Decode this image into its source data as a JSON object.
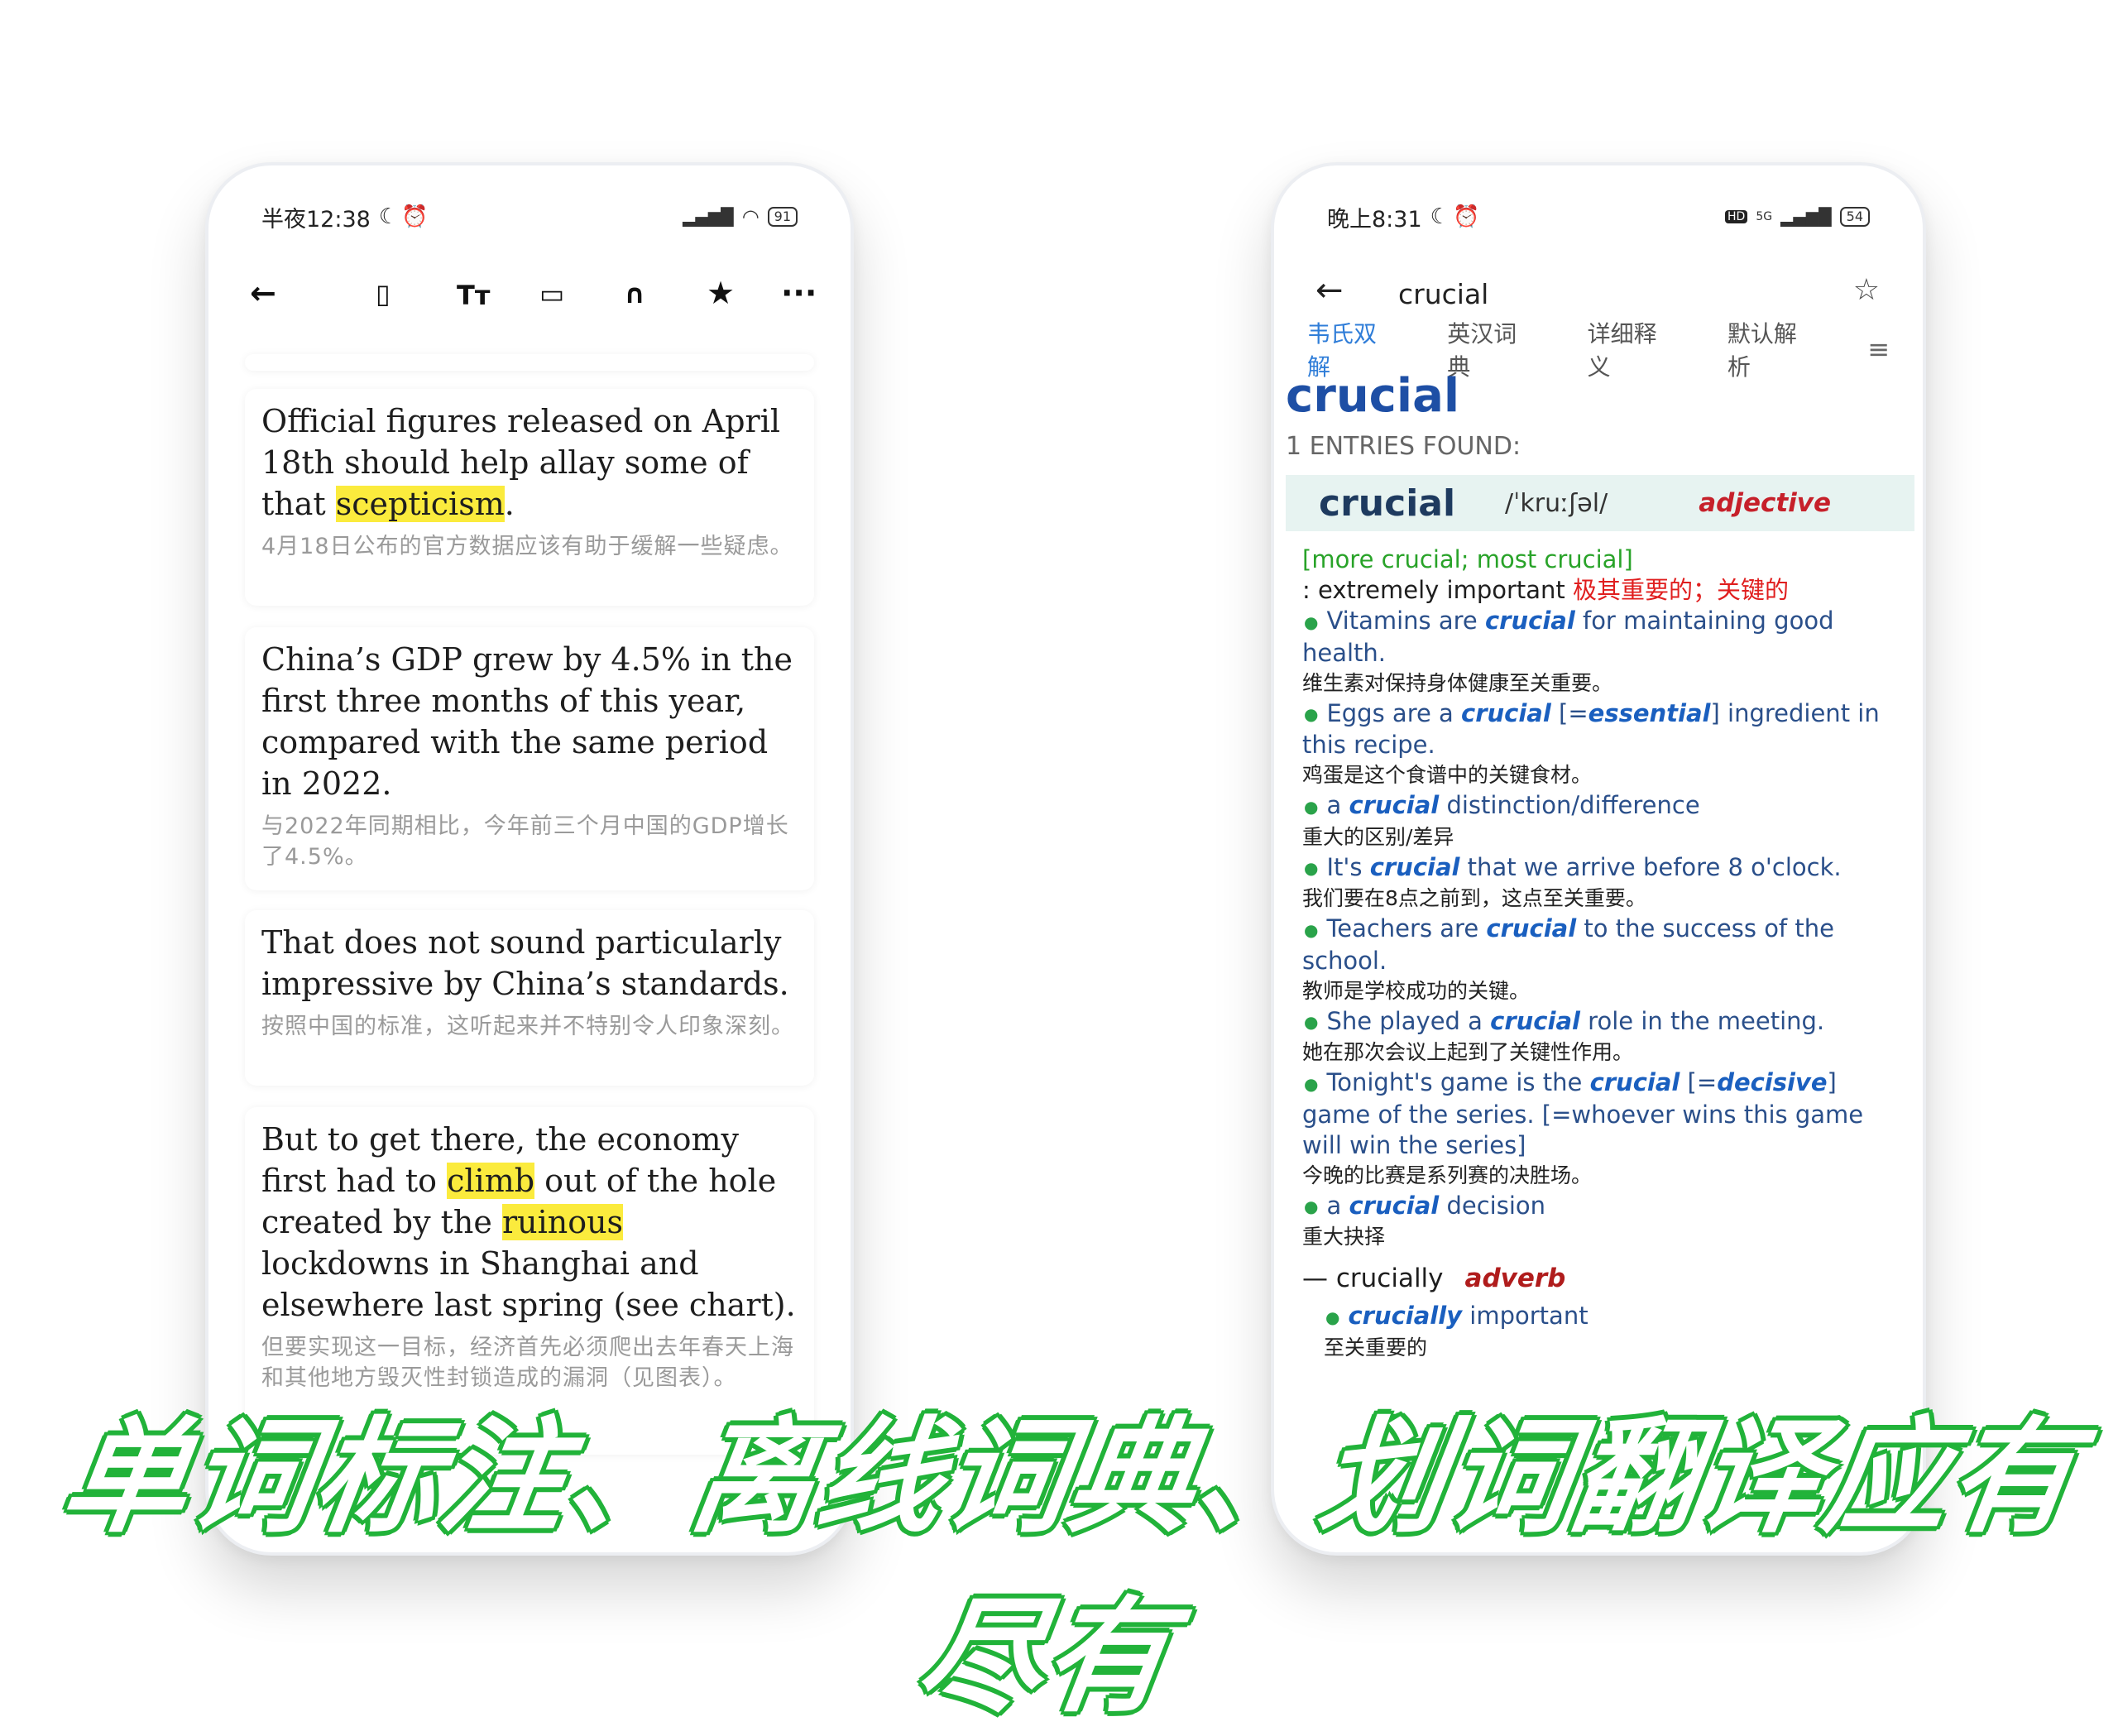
{
  "left_phone": {
    "status": {
      "time": "半夜12:38",
      "battery": "91"
    },
    "toolbar": [
      "back-arrow",
      "bookmark",
      "font-size",
      "reader-layout",
      "headphones",
      "star",
      "more"
    ],
    "cards": [
      {
        "en_parts": [
          "Official figures released on April 18th should help allay some of that ",
          "scepticism",
          "."
        ],
        "zh": "4月18日公布的官方数据应该有助于缓解一些疑虑。"
      },
      {
        "en_parts": [
          "China’s GDP grew by 4.5% in the first three months of this year, compared with the same period in 2022."
        ],
        "zh": "与2022年同期相比，今年前三个月中国的GDP增长了4.5%。"
      },
      {
        "en_parts": [
          "That does not sound particularly impressive by China’s standards."
        ],
        "zh": "按照中国的标准，这听起来并不特别令人印象深刻。"
      },
      {
        "en_parts": [
          "But to get there, the economy first had to ",
          "climb",
          " out of the hole created by the ",
          "ruinous",
          " lockdowns in Shanghai and elsewhere last spring (see chart)."
        ],
        "zh": "但要实现这一目标，经济首先必须爬出去年春天上海和其他地方毁灭性封锁造成的漏洞（见图表）。"
      }
    ]
  },
  "right_phone": {
    "status": {
      "time": "晚上8:31",
      "battery": "54",
      "network": "5G"
    },
    "search_word": "crucial",
    "tabs": [
      "韦氏双解",
      "英汉词典",
      "详细释义",
      "默认解析"
    ],
    "headword": "crucial",
    "entries_found": "1 ENTRIES FOUND:",
    "entry": {
      "word": "crucial",
      "pron": "/ˈkruːʃəl/",
      "pos": "adjective"
    },
    "inflections": "[more crucial; most crucial]",
    "definition": ": extremely important",
    "definition_zh": "极其重要的；关键的",
    "examples": [
      {
        "pre": "Vitamins are ",
        "kw": "crucial",
        "post": " for maintaining good health.",
        "zh": "维生素对保持身体健康至关重要。"
      },
      {
        "pre": "Eggs are a ",
        "kw": "crucial",
        "syn": "essential",
        "post": " ingredient in this recipe.",
        "zh": "鸡蛋是这个食谱中的关键食材。"
      },
      {
        "pre": "a ",
        "kw": "crucial",
        "post": " distinction/difference",
        "zh": "重大的区别/差异"
      },
      {
        "pre": "It's ",
        "kw": "crucial",
        "post": " that we arrive before 8 o'clock.",
        "zh": "我们要在8点之前到，这点至关重要。"
      },
      {
        "pre": "Teachers are ",
        "kw": "crucial",
        "post": " to the success of the school.",
        "zh": "教师是学校成功的关键。"
      },
      {
        "pre": "She played a ",
        "kw": "crucial",
        "post": " role in the meeting.",
        "zh": "她在那次会议上起到了关键性作用。"
      },
      {
        "pre": "Tonight's game is the ",
        "kw": "crucial",
        "syn": "decisive",
        "post": " game of the series. [=whoever wins this game will win the series]",
        "zh": "今晚的比赛是系列赛的决胜场。"
      },
      {
        "pre": "a ",
        "kw": "crucial",
        "post": " decision",
        "zh": "重大抉择"
      }
    ],
    "run_on": {
      "dash": "—",
      "word": "crucially",
      "pos": "adverb"
    },
    "run_on_example": {
      "kw": "crucially",
      "post": " important",
      "zh": "至关重要的"
    }
  },
  "caption": "单词标注、离线词典、划词翻译应有尽有"
}
